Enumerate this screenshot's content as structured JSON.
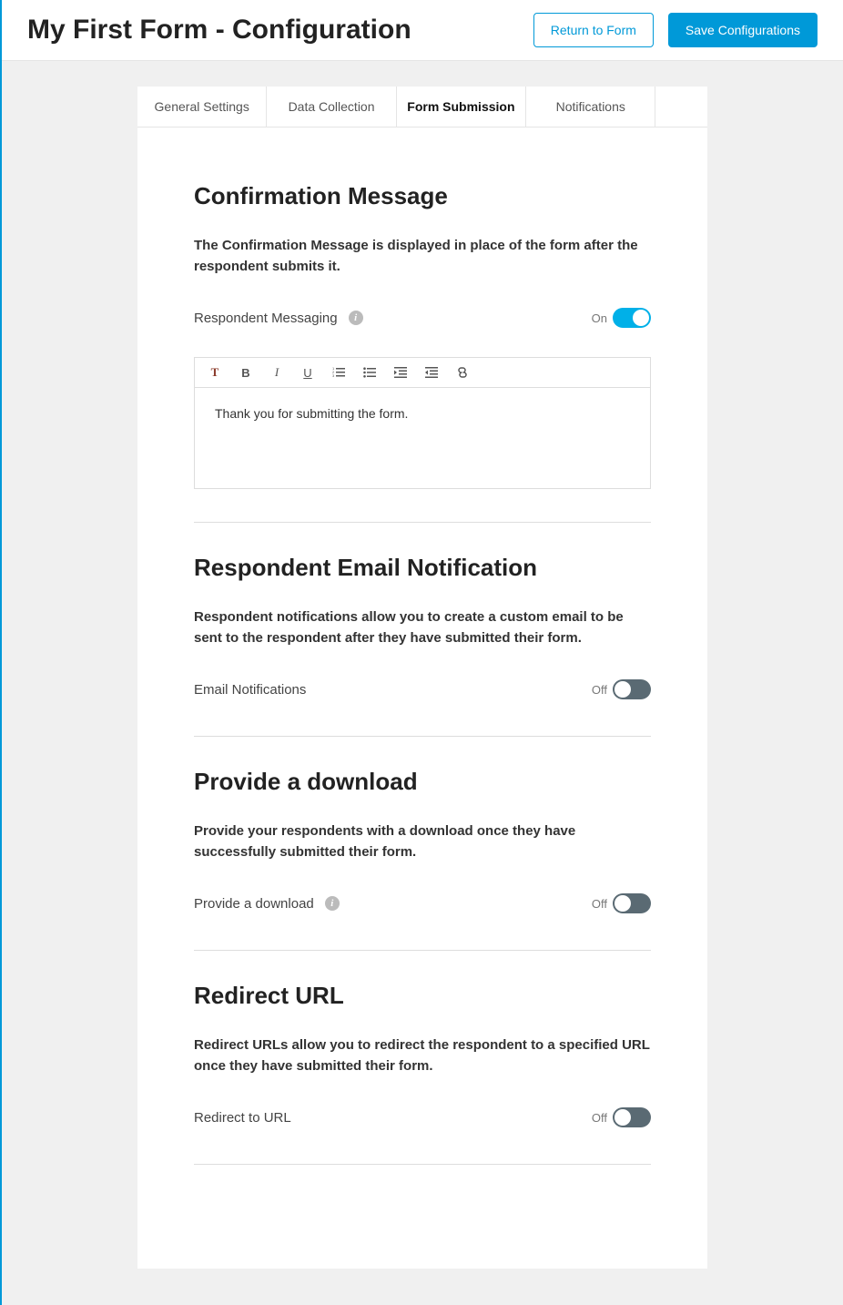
{
  "header": {
    "title": "My First Form - Configuration",
    "return_btn": "Return to Form",
    "save_btn": "Save Configurations"
  },
  "tabs": {
    "general": "General Settings",
    "data": "Data Collection",
    "submission": "Form Submission",
    "notifications": "Notifications",
    "active_index": 2
  },
  "toggle_labels": {
    "on": "On",
    "off": "Off"
  },
  "sections": {
    "confirmation": {
      "title": "Confirmation Message",
      "desc": "The Confirmation Message is displayed in place of the form after the respondent submits it.",
      "option_label": "Respondent Messaging",
      "toggle_on": true,
      "editor_content": "Thank you for submitting the form."
    },
    "email": {
      "title": "Respondent Email Notification",
      "desc": "Respondent notifications allow you to create a custom email to be sent to the respondent after they have submitted their form.",
      "option_label": "Email Notifications",
      "toggle_on": false
    },
    "download": {
      "title": "Provide a download",
      "desc": "Provide your respondents with a download once they have successfully submitted their form.",
      "option_label": "Provide a download",
      "toggle_on": false
    },
    "redirect": {
      "title": "Redirect URL",
      "desc": "Redirect URLs allow you to redirect the respondent to a specified URL once they have submitted their form.",
      "option_label": "Redirect to URL",
      "toggle_on": false
    }
  }
}
